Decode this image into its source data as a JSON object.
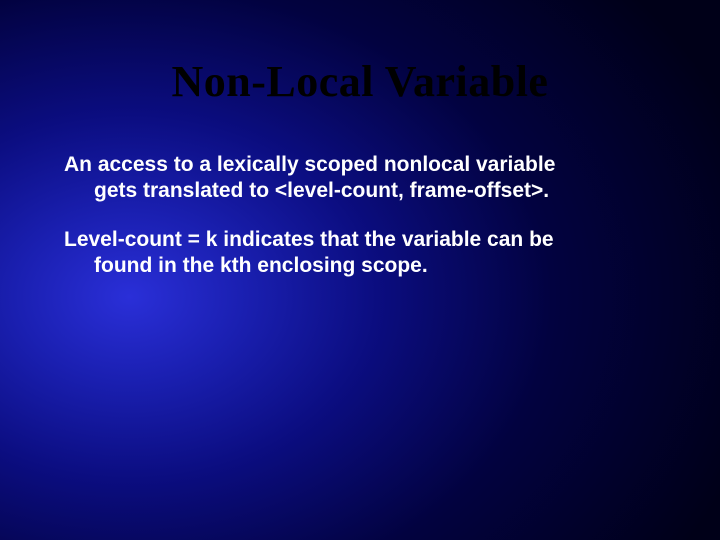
{
  "slide": {
    "title": "Non-Local Variable",
    "paragraphs": [
      {
        "line1": "An access to a lexically scoped nonlocal variable",
        "line2": "gets translated to <level-count, frame-offset>."
      },
      {
        "line1": "Level-count = k indicates that the variable can be",
        "line2": "found in the kth enclosing scope."
      }
    ]
  }
}
